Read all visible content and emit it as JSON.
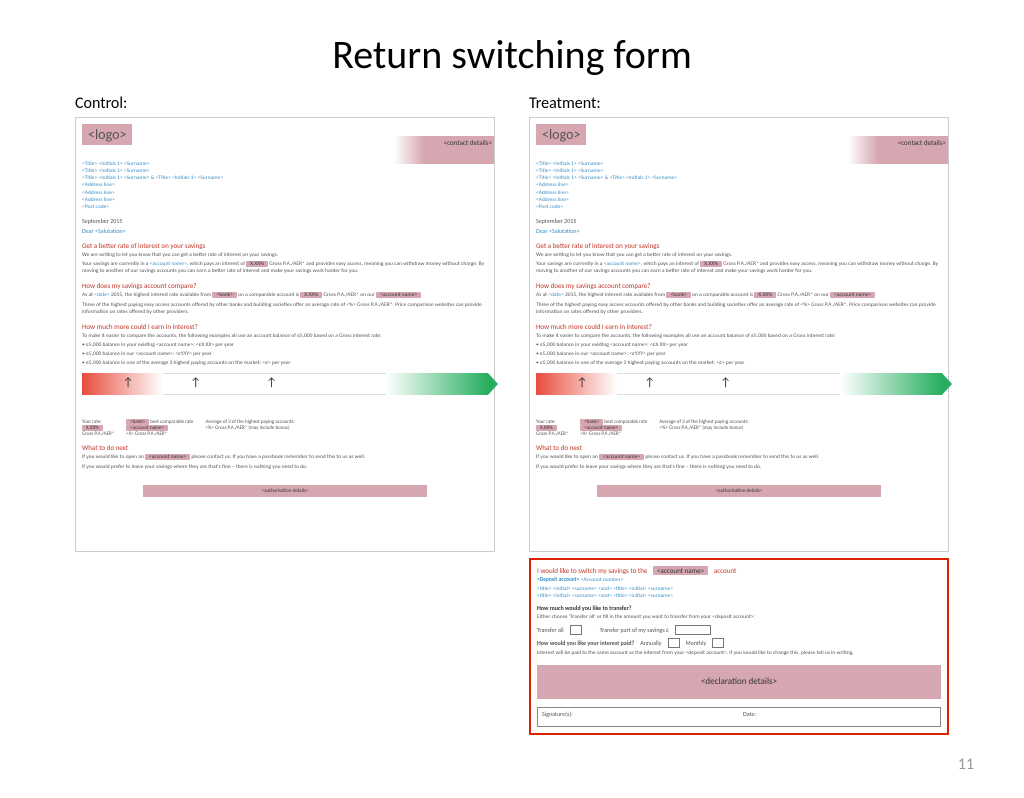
{
  "title": "Return switching form",
  "page_number": "11",
  "labels": {
    "control": "Control:",
    "treatment": "Treatment:"
  },
  "doc": {
    "logo": "<logo>",
    "contact": "<contact details>",
    "address_lines": "<Title> <Initials 1> <Surname>\n<Title> <Initials 1> <Surname>\n<Title> <Initials 1> <Surname> & <Title> <Initials 1> <Surname>\n<Address line>\n<Address line>\n<Address line>\n<Post code>",
    "date": "September 2015",
    "salutation_prefix": "Dear ",
    "salutation_name": "<Salutation>",
    "h1": "Get a better rate of interest on your savings",
    "p1": "We are writing to let you know that you can get a better rate of interest on your savings.",
    "p2a": "Your savings are currently in a ",
    "p2_acct": "<account name>",
    "p2b": ", which pays an interest of ",
    "p2_rate": "X.XX%",
    "p2c": " Gross P.A./AER* and provides easy access, meaning you can withdraw money without charge. By moving to another of our savings accounts you can earn a better rate of interest and make your savings work harder for you.",
    "h2": "How does my savings account compare?",
    "p3a": "As at ",
    "p3_date": "<date>",
    "p3b": " 2015, the highest interest rate available from ",
    "p3_bank": "<bank>",
    "p3c": " on a comparable account is ",
    "p3_rate": "X.XX%",
    "p3d": " Gross P.A./AER* on our ",
    "p3_acct": "<account name>",
    "p4": "Three of the highest paying easy access accounts offered by other banks and building societies offer an average rate of <%> Gross P.A./AER*. Price comparison websites can provide information on rates offered by other providers.",
    "h3": "How much more could I earn in interest?",
    "p5": "To make it easier to compare the accounts, the following examples all use an account balance of £5,000 based on a Gross interest rate:",
    "b1": "• £5,000 balance in your existing <account name>: <£X.XX> per year",
    "b2": "• £5,000 balance in our <account name>: <£Y.YY> per year",
    "b3": "• £5,000 balance in one of the average 3 highest paying accounts on the market: <£> per year",
    "cmp": {
      "c1a": "Your rate:",
      "c1_rate": "X.XX%",
      "c1b": "Gross P.A./AER*",
      "c2_bank": "<bank>",
      "c2a": "best comparable rate",
      "c2_acct": "<account name>",
      "c2b": "<X> Gross P.A./AER*",
      "c3a": "Average of 3 of the highest paying accounts:",
      "c3b": "<%> Gross P.A./AER* (may include bonus)"
    },
    "h4": "What to do next",
    "p6a": "If you would like to open an ",
    "p6_acct": "<account name>",
    "p6b": " please contact us. If you have a passbook remember to send this to us as well.",
    "p7": "If you would prefer to leave your savings where they are that's fine – there is nothing you need to do.",
    "footer": "<authorisation details>"
  },
  "tear": {
    "head_a": "I would like to switch my savings to the",
    "head_acct": "<account name>",
    "head_b": "account",
    "deposit_label": "<Deposit account>",
    "acct_no": "<Account number>",
    "name_lines": "<title> <initial> <surname> <and> <title> <initial> <surname>\n<title> <initial> <surname> <and> <title> <initial> <surname>",
    "q1": "How much would you like to transfer?",
    "q1_sub": "Either choose 'Transfer all' or fill in the amount you want to transfer from your <deposit account>:",
    "opt_all": "Transfer all",
    "opt_part": "Transfer part of my savings   £",
    "q2": "How would you like your interest paid?",
    "opt_ann": "Annually",
    "opt_mon": "Monthly",
    "q2_note": "Interest will be paid to the same account as the interest from your <deposit account>. If you would like to change this, please tell us in writing.",
    "decl": "<declaration details>",
    "sig": "Signature(s):",
    "date": "Date:"
  }
}
